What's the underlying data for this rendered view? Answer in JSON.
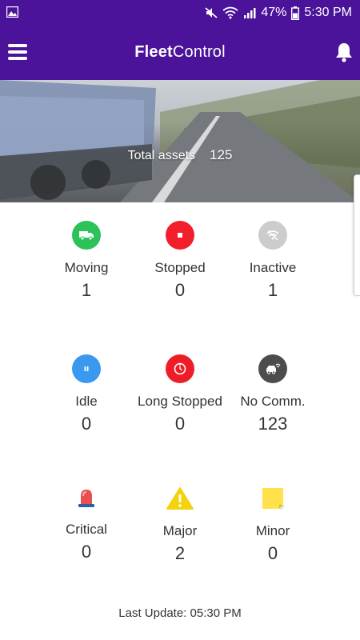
{
  "status_bar": {
    "battery": "47%",
    "time": "5:30 PM"
  },
  "app": {
    "title_bold": "Fleet",
    "title_regular": "Control"
  },
  "summary": {
    "label": "Total assets",
    "value": "125"
  },
  "stats": [
    {
      "label": "Moving",
      "count": "1",
      "color": "#2bc25a",
      "icon": "truck-icon"
    },
    {
      "label": "Stopped",
      "count": "0",
      "color": "#f21e2a",
      "icon": "stop-icon"
    },
    {
      "label": "Inactive",
      "count": "1",
      "color": "#cccccc",
      "icon": "no-signal-icon"
    },
    {
      "label": "Idle",
      "count": "0",
      "color": "#3a99ee",
      "icon": "pause-icon"
    },
    {
      "label": "Long Stopped",
      "count": "0",
      "color": "#ee1c26",
      "icon": "timer-icon"
    },
    {
      "label": "No Comm.",
      "count": "123",
      "color": "#4c4c4c",
      "icon": "no-comm-icon"
    },
    {
      "label": "Critical",
      "count": "0",
      "color": "#e85050",
      "icon": "siren-icon"
    },
    {
      "label": "Major",
      "count": "2",
      "color": "#f4d20c",
      "icon": "warning-icon"
    },
    {
      "label": "Minor",
      "count": "0",
      "color": "#ffe14a",
      "icon": "sticky-note-icon"
    }
  ],
  "footer": {
    "last_update": "Last Update: 05:30 PM"
  }
}
